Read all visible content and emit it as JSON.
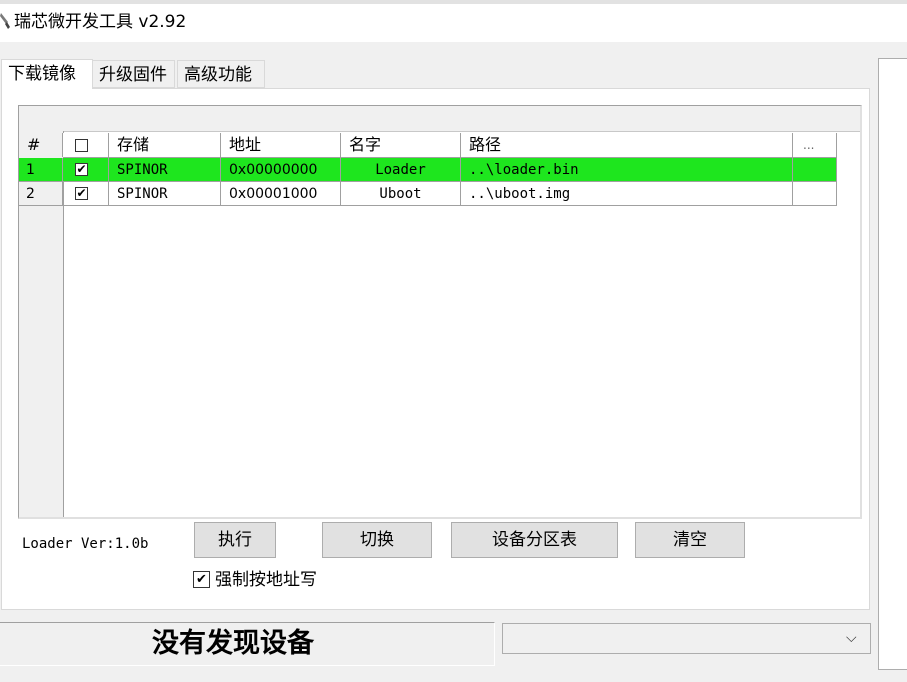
{
  "window": {
    "title": "瑞芯微开发工具 v2.92"
  },
  "tabs": [
    {
      "label": "下载镜像",
      "active": true
    },
    {
      "label": "升级固件",
      "active": false
    },
    {
      "label": "高级功能",
      "active": false
    }
  ],
  "grid": {
    "columns": [
      "#",
      "☐",
      "存储",
      "地址",
      "名字",
      "路径",
      "..."
    ],
    "rows": [
      {
        "num": "1",
        "checked": "✔",
        "storage": "SPINOR",
        "address": "0x00000000",
        "name": "Loader",
        "path": "..\\loader.bin",
        "highlight": "#1ee61e"
      },
      {
        "num": "2",
        "checked": "✔",
        "storage": "SPINOR",
        "address": "0x00001000",
        "name": "Uboot",
        "path": "..\\uboot.img",
        "highlight": ""
      }
    ]
  },
  "loader_version": "Loader Ver:1.0b",
  "buttons": {
    "execute": "执行",
    "switch": "切换",
    "partition_table": "设备分区表",
    "clear": "清空"
  },
  "force_address_write": {
    "label": "强制按地址写",
    "checked": "✔"
  },
  "status": {
    "text": "没有发现设备"
  },
  "device_combo": {
    "value": "",
    "arrow": "⌵"
  },
  "colors": {
    "row_highlight": "#1ee61e",
    "button_bg": "#e1e1e1",
    "window_bg": "#f0f0f0"
  }
}
